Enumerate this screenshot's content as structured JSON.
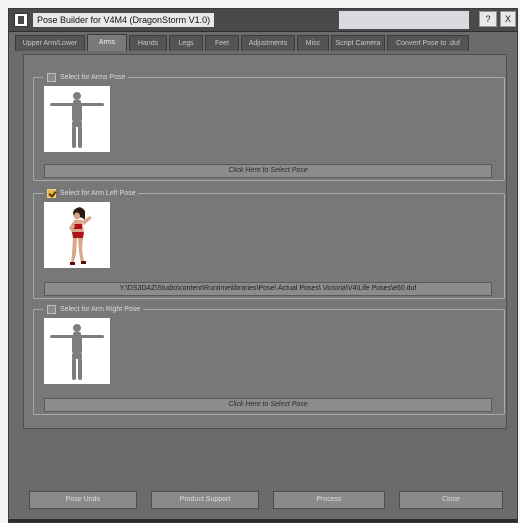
{
  "window": {
    "title": "Pose Builder for V4M4 (DragonStorm V1.0)",
    "help_label": "?",
    "close_label": "X"
  },
  "tabs": [
    {
      "label": "Upper Arm/Lower",
      "active": false
    },
    {
      "label": "Arms",
      "active": true
    },
    {
      "label": "Hands",
      "active": false
    },
    {
      "label": "Legs",
      "active": false
    },
    {
      "label": "Feet",
      "active": false
    },
    {
      "label": "Adjustments",
      "active": false
    },
    {
      "label": "Misc",
      "active": false
    },
    {
      "label": "Script Camera",
      "active": false
    },
    {
      "label": "Convert Pose to .duf",
      "active": false
    }
  ],
  "groups": [
    {
      "label": "Select for Arms Pose",
      "checked": false,
      "button_label": "Click Here to Select Pose",
      "thumb_icon": "tpose-figure-icon"
    },
    {
      "label": "Select for Arm Left Pose",
      "checked": true,
      "button_label": "Y:\\DS3DAZ\\Studio\\content\\Runtime\\libraries\\Pose\\ Actual Poses\\ Victoria\\V4\\Life Poses\\e60.duf",
      "thumb_icon": "posed-woman-icon"
    },
    {
      "label": "Select for Arm Right Pose",
      "checked": false,
      "button_label": "Click Here to Select Pose",
      "thumb_icon": "tpose-figure-icon"
    }
  ],
  "bottom_buttons": [
    {
      "label": "Pose Undo"
    },
    {
      "label": "Product Support"
    },
    {
      "label": "Process"
    },
    {
      "label": "Close"
    }
  ],
  "colors": {
    "window_bg": "#6b6b6b",
    "panel_bg": "#787878",
    "checkbox_on": "#e6b84a"
  }
}
